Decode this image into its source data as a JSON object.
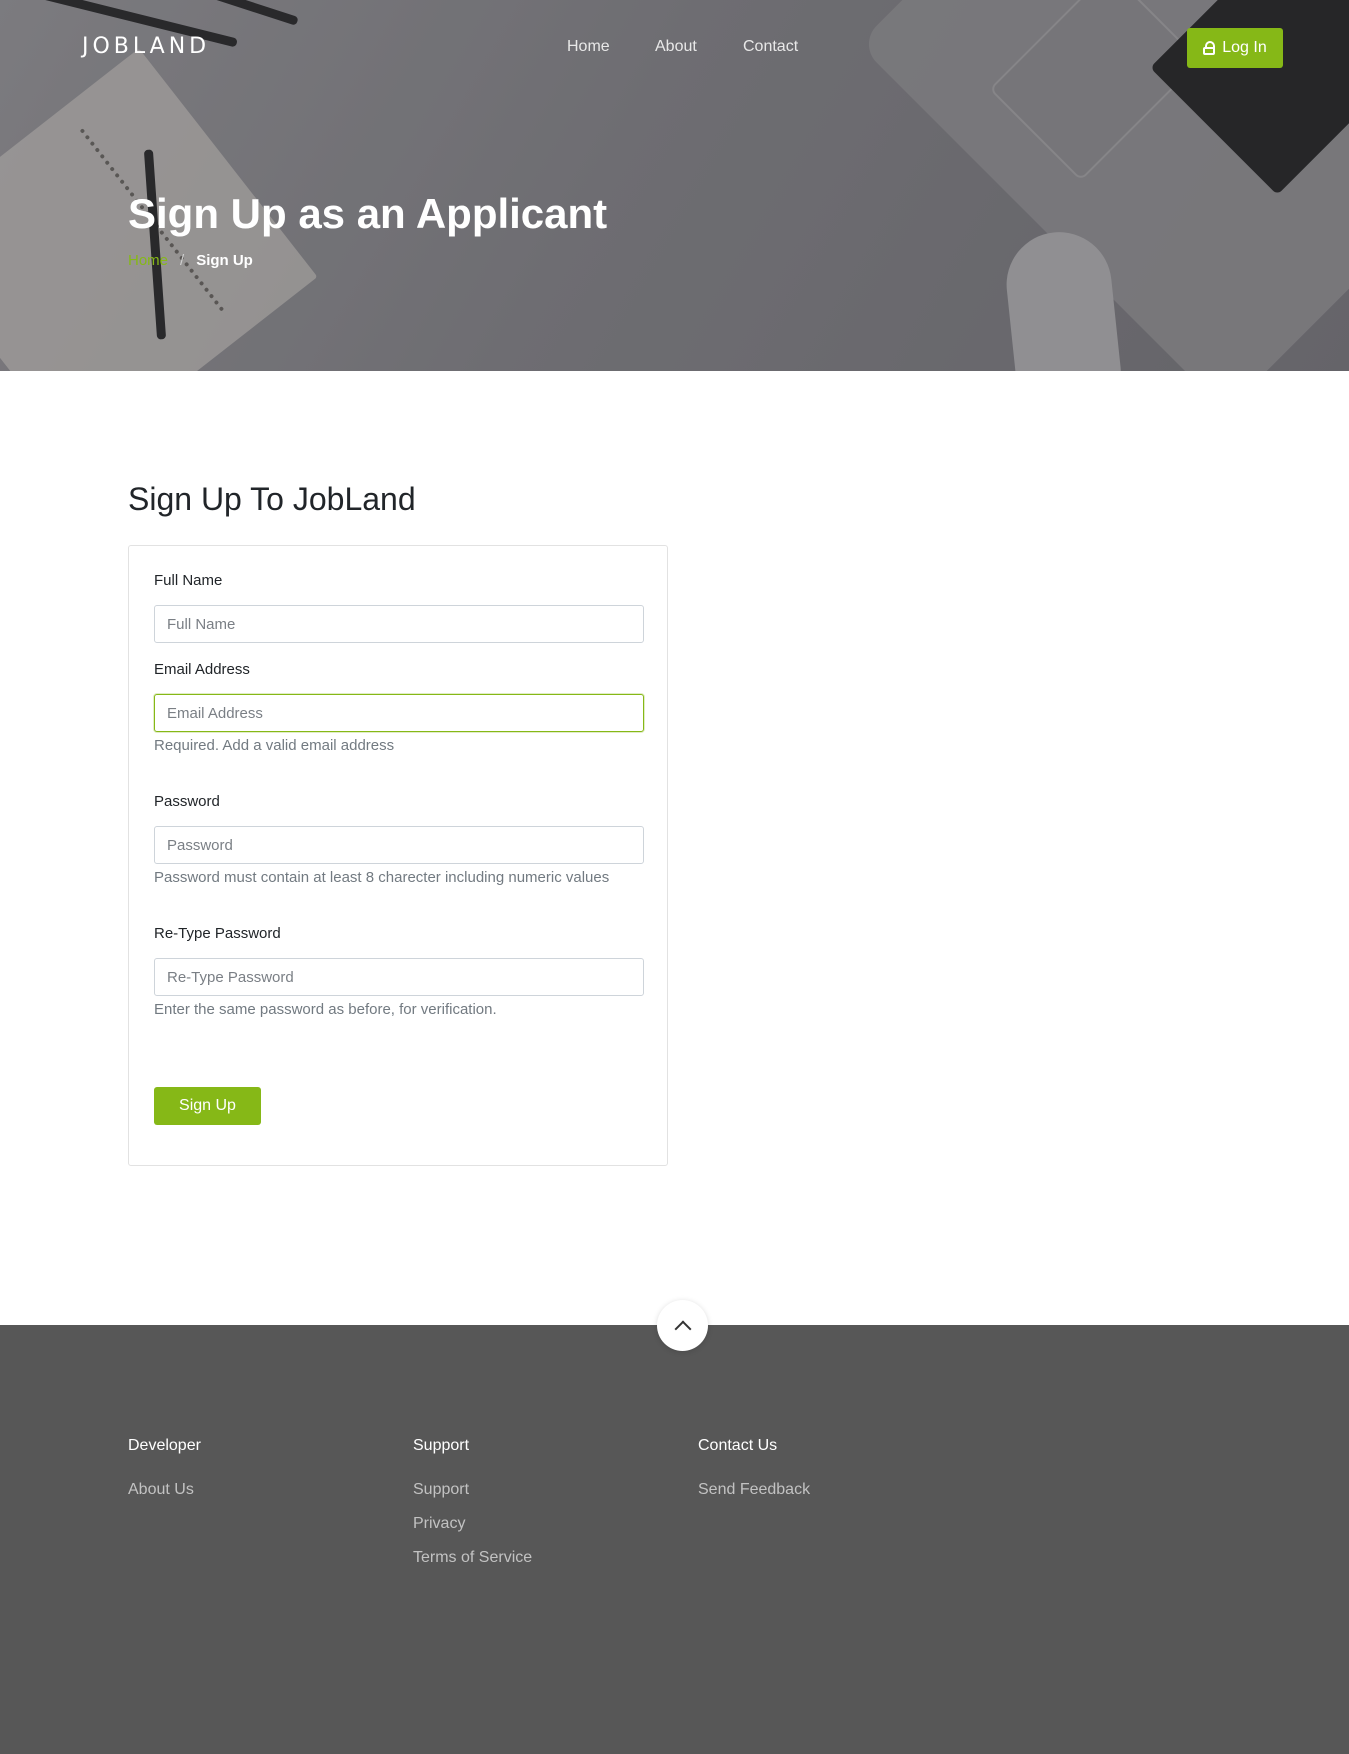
{
  "header": {
    "logo": "JOBLAND",
    "nav": [
      "Home",
      "About",
      "Contact"
    ],
    "login_label": "Log In"
  },
  "hero": {
    "title": "Sign Up as an Applicant",
    "breadcrumb": {
      "home": "Home",
      "separator": "/",
      "current": "Sign Up"
    }
  },
  "form": {
    "heading": "Sign Up To JobLand",
    "fields": [
      {
        "label": "Full Name",
        "placeholder": "Full Name",
        "help": ""
      },
      {
        "label": "Email Address",
        "placeholder": "Email Address",
        "help": "Required. Add a valid email address"
      },
      {
        "label": "Password",
        "placeholder": "Password",
        "help": "Password must contain at least 8 charecter including numeric values"
      },
      {
        "label": "Re-Type Password",
        "placeholder": "Re-Type Password",
        "help": "Enter the same password as before, for verification."
      }
    ],
    "submit_label": "Sign Up"
  },
  "footer": {
    "columns": [
      {
        "title": "Developer",
        "links": [
          "About Us"
        ]
      },
      {
        "title": "Support",
        "links": [
          "Support",
          "Privacy",
          "Terms of Service"
        ]
      },
      {
        "title": "Contact Us",
        "links": [
          "Send Feedback"
        ]
      }
    ]
  },
  "colors": {
    "accent": "#86b817",
    "footer_bg": "#575757"
  },
  "icons": {
    "login": "lock-icon",
    "back_to_top": "chevron-up-icon"
  }
}
